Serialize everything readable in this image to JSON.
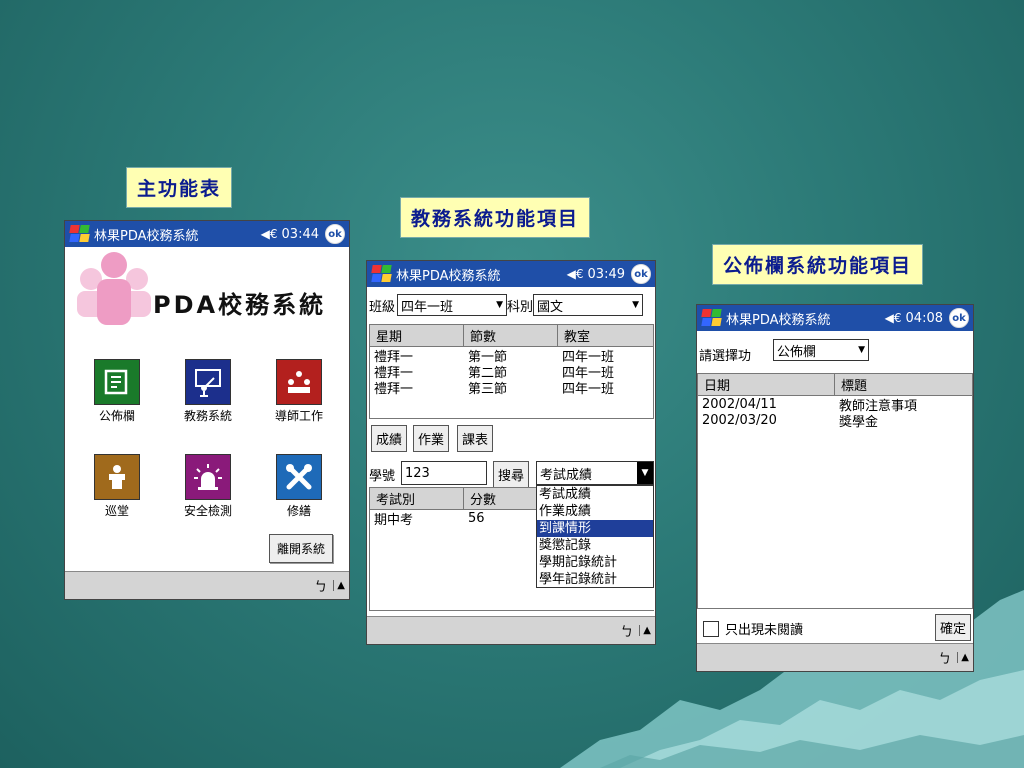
{
  "captions": {
    "main_menu": "主功能表",
    "academic": "教務系統功能項目",
    "bulletin": "公佈欄系統功能項目"
  },
  "titlebar": {
    "app_title": "林果PDA校務系統",
    "speaker": "◀€",
    "ok": "ok"
  },
  "screen_main": {
    "clock": "03:44",
    "logo_text": "PDA校務系統",
    "icons": [
      {
        "label": "公佈欄",
        "icon": "bulletin-icon",
        "color": "#1a7a2a"
      },
      {
        "label": "教務系統",
        "icon": "teaching-icon",
        "color": "#1c2f8c"
      },
      {
        "label": "導師工作",
        "icon": "mentor-icon",
        "color": "#b3201e"
      },
      {
        "label": "巡堂",
        "icon": "patrol-icon",
        "color": "#a06a1c"
      },
      {
        "label": "安全檢測",
        "icon": "alarm-icon",
        "color": "#8a1a7a"
      },
      {
        "label": "修繕",
        "icon": "repair-icon",
        "color": "#1e6ab8"
      }
    ],
    "exit_button": "離開系統"
  },
  "screen_academic": {
    "clock": "03:49",
    "class_label": "班級",
    "class_value": "四年一班",
    "subject_label": "科別",
    "subject_value": "國文",
    "schedule_headers": [
      "星期",
      "節數",
      "教室"
    ],
    "schedule_rows": [
      [
        "禮拜一",
        "第一節",
        "四年一班"
      ],
      [
        "禮拜一",
        "第二節",
        "四年一班"
      ],
      [
        "禮拜一",
        "第三節",
        "四年一班"
      ]
    ],
    "tabs": [
      "成績",
      "作業",
      "課表"
    ],
    "student_label": "學號",
    "student_value": "123",
    "search_button": "搜尋",
    "dropdown_value": "考試成績",
    "dropdown_options": [
      "考試成績",
      "作業成績",
      "到課情形",
      "獎懲記錄",
      "學期記錄統計",
      "學年記錄統計"
    ],
    "dropdown_selected_index": 2,
    "score_headers": [
      "考試別",
      "分數"
    ],
    "score_rows": [
      [
        "期中考",
        "56"
      ]
    ]
  },
  "screen_bulletin": {
    "clock": "04:08",
    "select_label": "請選擇功",
    "select_value": "公佈欄",
    "headers": [
      "日期",
      "標題"
    ],
    "rows": [
      [
        "2002/04/11",
        "教師注意事項"
      ],
      [
        "2002/03/20",
        "獎學金"
      ]
    ],
    "unread_label": "只出現未閱讀",
    "confirm_button": "確定"
  },
  "colors": {
    "titlebar": "#1f4fa8",
    "caption_bg": "#ffffb3",
    "caption_text": "#0c1c8f",
    "selection": "#1f3f9a"
  }
}
